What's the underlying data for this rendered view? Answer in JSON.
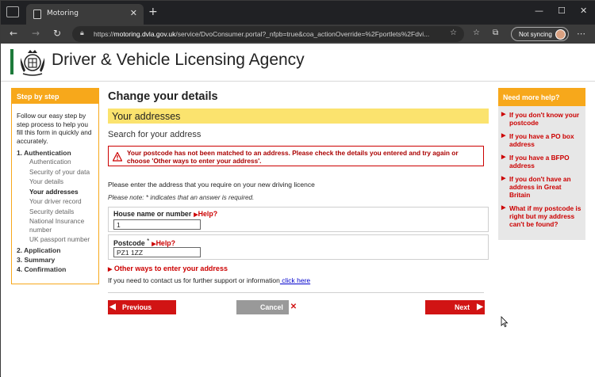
{
  "browser": {
    "tab_title": "Motoring",
    "new_tab_symbol": "+",
    "close_symbol": "✕",
    "url_prefix": "https://",
    "url_host": "motoring.dvla.gov.uk",
    "url_path": "/service/DvoConsumer.portal?_nfpb=true&coa_actionOverride=%2Fportlets%2Fdvi...",
    "sync_label": "Not syncing",
    "window_controls": [
      "—",
      "☐",
      "✕"
    ]
  },
  "site": {
    "agency_name": "Driver & Vehicle Licensing Agency"
  },
  "left_panel": {
    "header": "Step by step",
    "intro": "Follow our easy step by step process to help you fill this form in quickly and accurately.",
    "steps": [
      {
        "label": "1. Authentication"
      },
      {
        "label": "2. Application"
      },
      {
        "label": "3. Summary"
      },
      {
        "label": "4. Confirmation"
      }
    ],
    "substeps": [
      "Authentication",
      "Security of your data",
      "Your details",
      "Your addresses",
      "Your driver record",
      "Security details",
      "National Insurance number",
      "UK passport number"
    ]
  },
  "main": {
    "title": "Change your details",
    "section": "Your addresses",
    "search_heading": "Search for your address",
    "error_message": "Your postcode has not been matched to an address. Please check the details you entered and try again or choose 'Other ways to enter your address'.",
    "enter_text": "Please enter the address that you require on your new driving licence",
    "note_text": "Please note: * indicates that an answer is required.",
    "house_label": "House name or number",
    "house_value": "1",
    "postcode_label": "Postcode",
    "postcode_required": "*",
    "postcode_value": "PZ1 1ZZ",
    "help_label": "Help?",
    "other_ways": "Other ways to enter your address",
    "contact_text": "If you need to contact us for further support or information",
    "contact_link": " click here",
    "prev_label": "Previous",
    "cancel_label": "Cancel",
    "next_label": "Next"
  },
  "right_panel": {
    "header": "Need more help?",
    "links": [
      "If you don't know your postcode",
      "If you have a PO box address",
      "If you have a BFPO address",
      "If you don't have an address in Great Britain",
      "What if my postcode is right but my address can't be found?"
    ]
  },
  "colors": {
    "accent_orange": "#f7a81b",
    "error_red": "#cc0000",
    "button_red": "#d11414",
    "section_yellow": "#fbe36e",
    "logo_green": "#1d7a3a"
  }
}
